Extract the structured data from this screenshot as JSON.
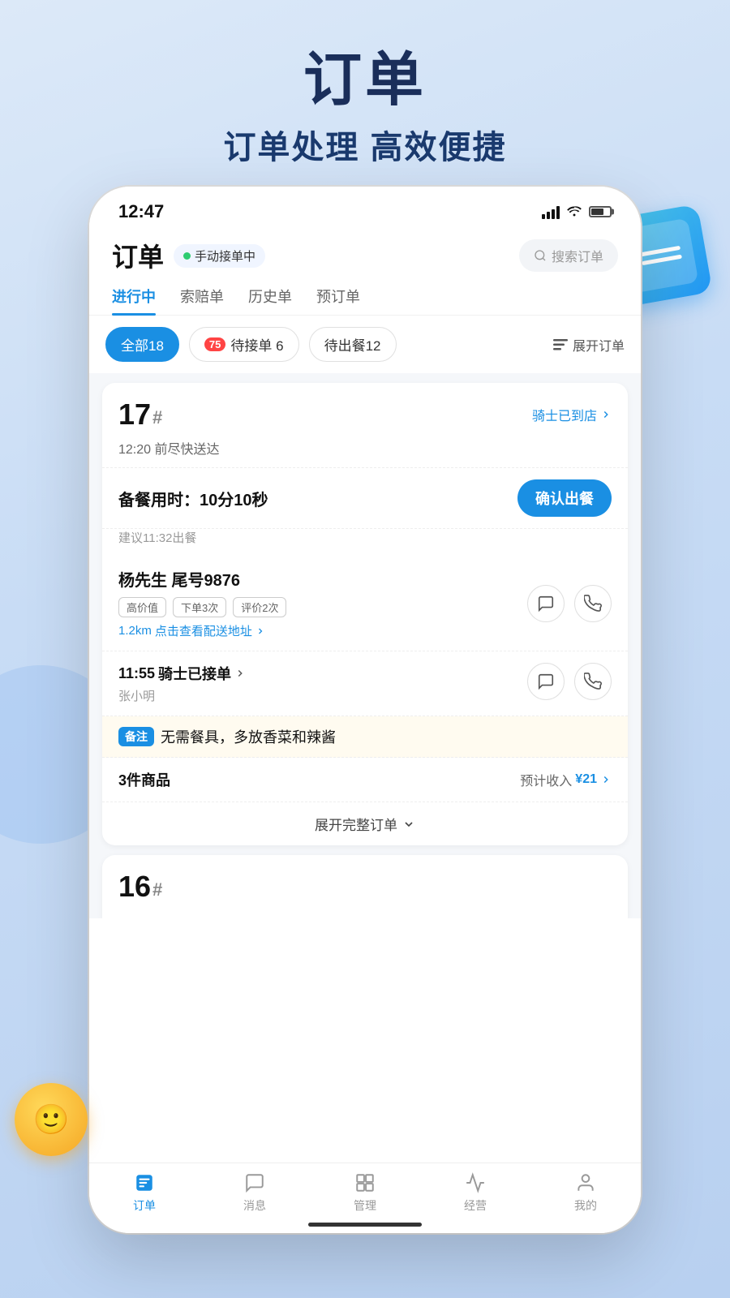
{
  "header": {
    "title": "订单",
    "subtitle": "订单处理 高效便捷"
  },
  "statusBar": {
    "time": "12:47"
  },
  "appHeader": {
    "title": "订单",
    "statusLabel": "手动接单中",
    "searchPlaceholder": "搜索订单"
  },
  "tabs": [
    {
      "label": "进行中",
      "active": true
    },
    {
      "label": "索赔单",
      "active": false
    },
    {
      "label": "历史单",
      "active": false
    },
    {
      "label": "预订单",
      "active": false
    }
  ],
  "filterChips": [
    {
      "label": "全部18",
      "active": true
    },
    {
      "label": "待接单 6",
      "badge": "75"
    },
    {
      "label": "待出餐12"
    }
  ],
  "expandLabel": "展开订单",
  "orders": [
    {
      "number": "17",
      "hash": "#",
      "riderStatus": "骑士已到店",
      "deliveryTime": "12:20 前尽快送达",
      "mealPrepLabel": "备餐用时：10分10秒",
      "confirmBtn": "确认出餐",
      "suggestTime": "建议11:32出餐",
      "customerName": "杨先生 尾号9876",
      "customerTags": [
        "高价值",
        "下单3次",
        "评价2次"
      ],
      "customerDist": "1.2km",
      "customerAddrText": "点击查看配送地址",
      "riderTime": "11:55",
      "riderStatusText": "骑士已接单",
      "riderName": "张小明",
      "remark": "无需餐具，多放香菜和辣酱",
      "itemsCount": "3件商品",
      "estimatedIncomeLabel": "预计收入",
      "estimatedIncomeAmount": "¥21",
      "expandLabel": "展开完整订单"
    }
  ],
  "order16": {
    "number": "16",
    "hash": "#"
  },
  "bottomNav": [
    {
      "label": "订单",
      "active": true,
      "icon": "orders-icon"
    },
    {
      "label": "消息",
      "active": false,
      "icon": "message-icon"
    },
    {
      "label": "管理",
      "active": false,
      "icon": "manage-icon"
    },
    {
      "label": "经营",
      "active": false,
      "icon": "analytics-icon"
    },
    {
      "label": "我的",
      "active": false,
      "icon": "profile-icon"
    }
  ],
  "colors": {
    "primary": "#1a8fe3",
    "background": "#dce9f8",
    "text": "#111111",
    "subtext": "#666666"
  }
}
